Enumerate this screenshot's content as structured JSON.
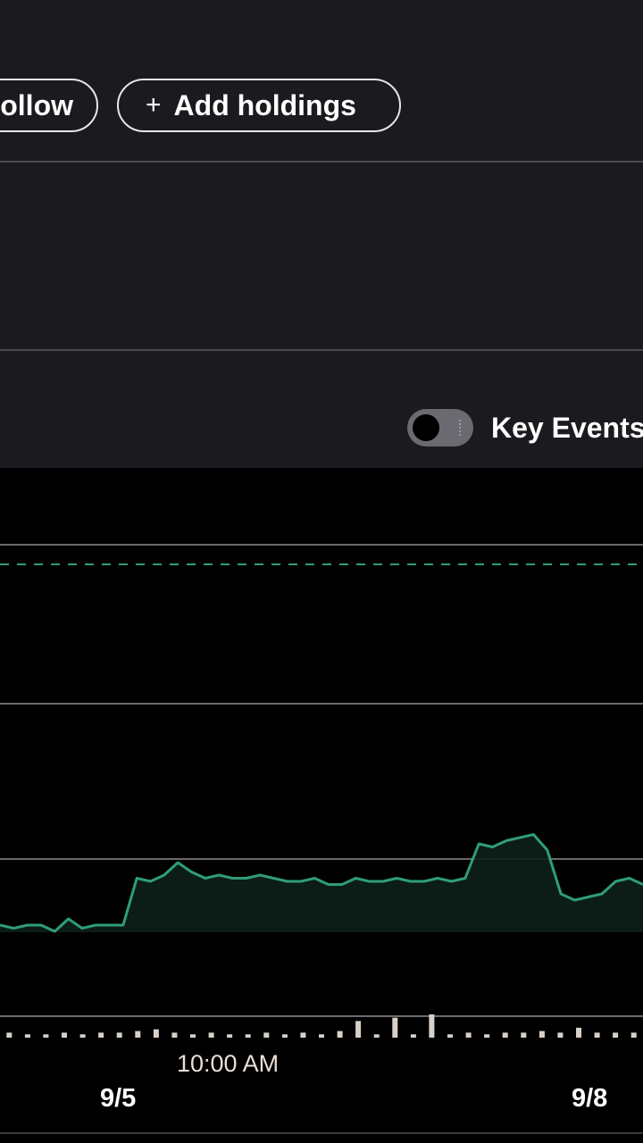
{
  "header": {
    "follow_label": "Follow",
    "add_holdings_label": "Add holdings",
    "plus_glyph": "+"
  },
  "toggle": {
    "label": "Key Events",
    "on": false
  },
  "colors": {
    "panel_bg": "#1b1b1f",
    "chart_bg": "#000000",
    "price_line": "#2f9e74",
    "volume_bars": "#d8d0c8",
    "gridline": "#6a6a6e"
  },
  "chart_data": {
    "type": "line",
    "x_tick_labels": [
      "10:00 AM"
    ],
    "date_labels": [
      "9/5",
      "9/8"
    ],
    "reference_line": "dashed",
    "series": [
      {
        "values": [
          38,
          37,
          38,
          38,
          36,
          40,
          37,
          38,
          38,
          38,
          53,
          52,
          54,
          58,
          55,
          53,
          54,
          53,
          53,
          54,
          53,
          52,
          52,
          53,
          51,
          51,
          53,
          52,
          52,
          53,
          52,
          52,
          53,
          52,
          53,
          64,
          63,
          65,
          66,
          67,
          62,
          48,
          46,
          47,
          48,
          52,
          53,
          51
        ]
      }
    ],
    "volume": [
      3,
      2,
      2,
      3,
      2,
      3,
      3,
      4,
      5,
      3,
      2,
      3,
      2,
      2,
      3,
      2,
      3,
      2,
      4,
      10,
      2,
      12,
      2,
      14,
      2,
      3,
      2,
      3,
      3,
      4,
      3,
      6,
      3,
      3,
      3
    ]
  }
}
